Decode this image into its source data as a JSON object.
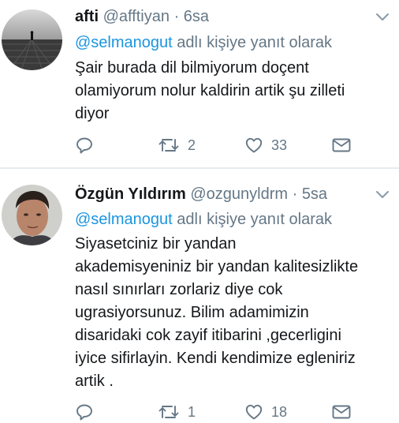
{
  "tweets": [
    {
      "name": "afti",
      "handle": "@afftiyan",
      "separator": "·",
      "time": "6sa",
      "reply_mention": "@selmanogut",
      "reply_suffix": " adlı kişiye yanıt olarak",
      "text_lines": [
        "Şair burada dil bilmiyorum doçent",
        "olamiyorum nolur kaldirin artik şu zilleti",
        "diyor"
      ],
      "retweets": "2",
      "likes": "33"
    },
    {
      "name": "Özgün Yıldırım",
      "handle": "@ozgunyldrm",
      "separator": "·",
      "time": "5sa",
      "reply_mention": "@selmanogut",
      "reply_suffix": " adlı kişiye yanıt olarak",
      "text_lines": [
        "Siyasetciniz bir yandan",
        "akademisyeniniz bir yandan kalitesizlikte",
        "nasıl sınırları zorlariz diye cok",
        "ugrasiyorsunuz. Bilim adamimizin",
        "disaridaki cok zayif itibarini ,gecerligini",
        "iyice sifirlayin. Kendi kendimize egleniriz",
        "artik ."
      ],
      "retweets": "1",
      "likes": "18"
    }
  ],
  "colors": {
    "link": "#1b95e0",
    "muted": "#657786",
    "text": "#14171a",
    "divider": "#e6ecf0"
  },
  "icons": [
    "reply-icon",
    "retweet-icon",
    "like-icon",
    "dm-icon",
    "chevron-down-icon"
  ]
}
